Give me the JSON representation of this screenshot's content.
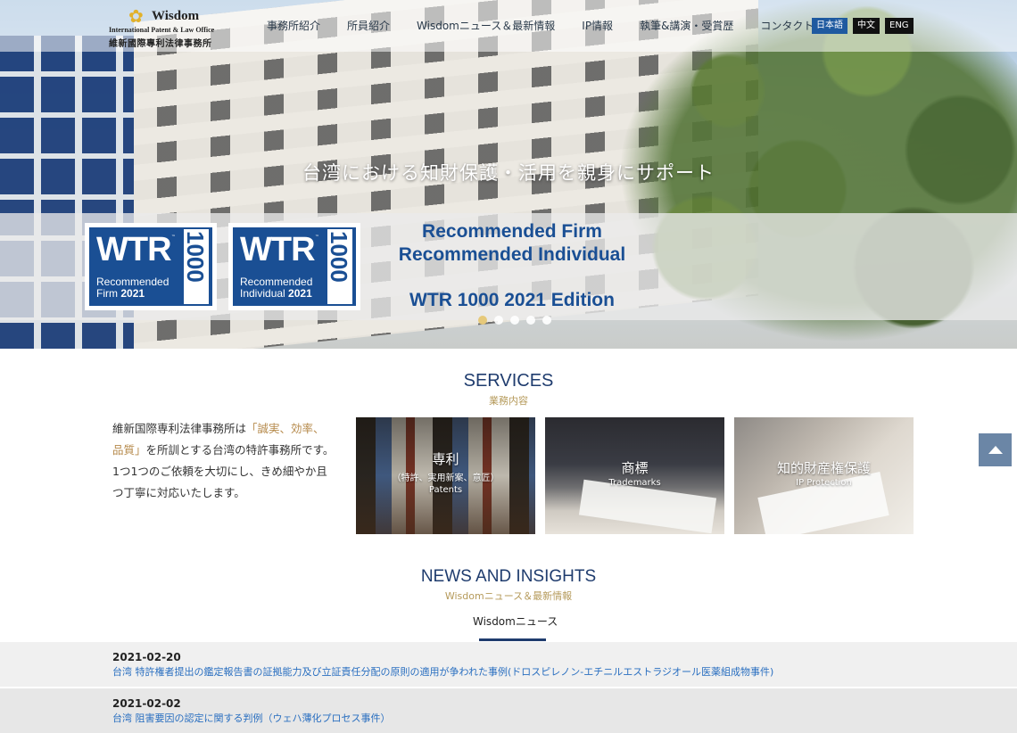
{
  "nav": {
    "logo": {
      "name": "Wisdom",
      "subtitle": "International Patent & Law Office",
      "name_cn": "維新國際專利法律事務所"
    },
    "menu": [
      "事務所紹介",
      "所員紹介",
      "Wisdomニュース＆最新情報",
      "IP情報",
      "執筆&講演・受賞歴",
      "コンタクト"
    ],
    "languages": [
      {
        "label": "日本語",
        "active": true
      },
      {
        "label": "中文",
        "active": false
      },
      {
        "label": "ENG",
        "active": false
      }
    ]
  },
  "hero": {
    "headline": "台湾における知財保護・活用を親身にサポート",
    "badges": [
      {
        "wtr": "WTR",
        "line1": "Recommended",
        "line2": "Firm",
        "year": "2021",
        "num": "1000"
      },
      {
        "wtr": "WTR",
        "line1": "Recommended",
        "line2": "Individual",
        "year": "2021",
        "num": "1000"
      }
    ],
    "banner_line1": "Recommended Firm",
    "banner_line2": "Recommended Individual",
    "banner_line3": "WTR 1000 2021 Edition",
    "slides_total": 5,
    "active_slide": 1,
    "accent_color": "#e6c97a"
  },
  "services": {
    "title": "SERVICES",
    "subtitle": "業務内容",
    "intro_part1": "維新国際専利法律事務所は",
    "intro_highlight": "「誠実、効率、品質」",
    "intro_part2": "を所訓とする台湾の特許事務所です。1つ1つのご依頼を大切にし、きめ細やか且つ丁寧に対応いたします。",
    "cards": [
      {
        "title": "専利",
        "middle": "（特許、実用新案、意匠）",
        "en": "Patents"
      },
      {
        "title": "商標",
        "en": "Trademarks"
      },
      {
        "title": "知的財産権保護",
        "en": "IP Protection"
      }
    ]
  },
  "news": {
    "title": "NEWS AND INSIGHTS",
    "subtitle": "Wisdomニュース＆最新情報",
    "tab": "Wisdomニュース",
    "items": [
      {
        "date": "2021-02-20",
        "text": "台湾 特許権者提出の鑑定報告書の証拠能力及び立証責任分配の原則の適用が争われた事例(ドロスピレノン-エチニルエストラジオール医薬組成物事件)"
      },
      {
        "date": "2021-02-02",
        "text": "台湾 阻害要因の認定に関する判例（ウェハ薄化プロセス事件）"
      }
    ]
  },
  "colors": {
    "brand_blue": "#1f3c6e",
    "lang_active": "#1f5aa0",
    "link": "#2a6fc0",
    "gold": "#b59a5a"
  }
}
